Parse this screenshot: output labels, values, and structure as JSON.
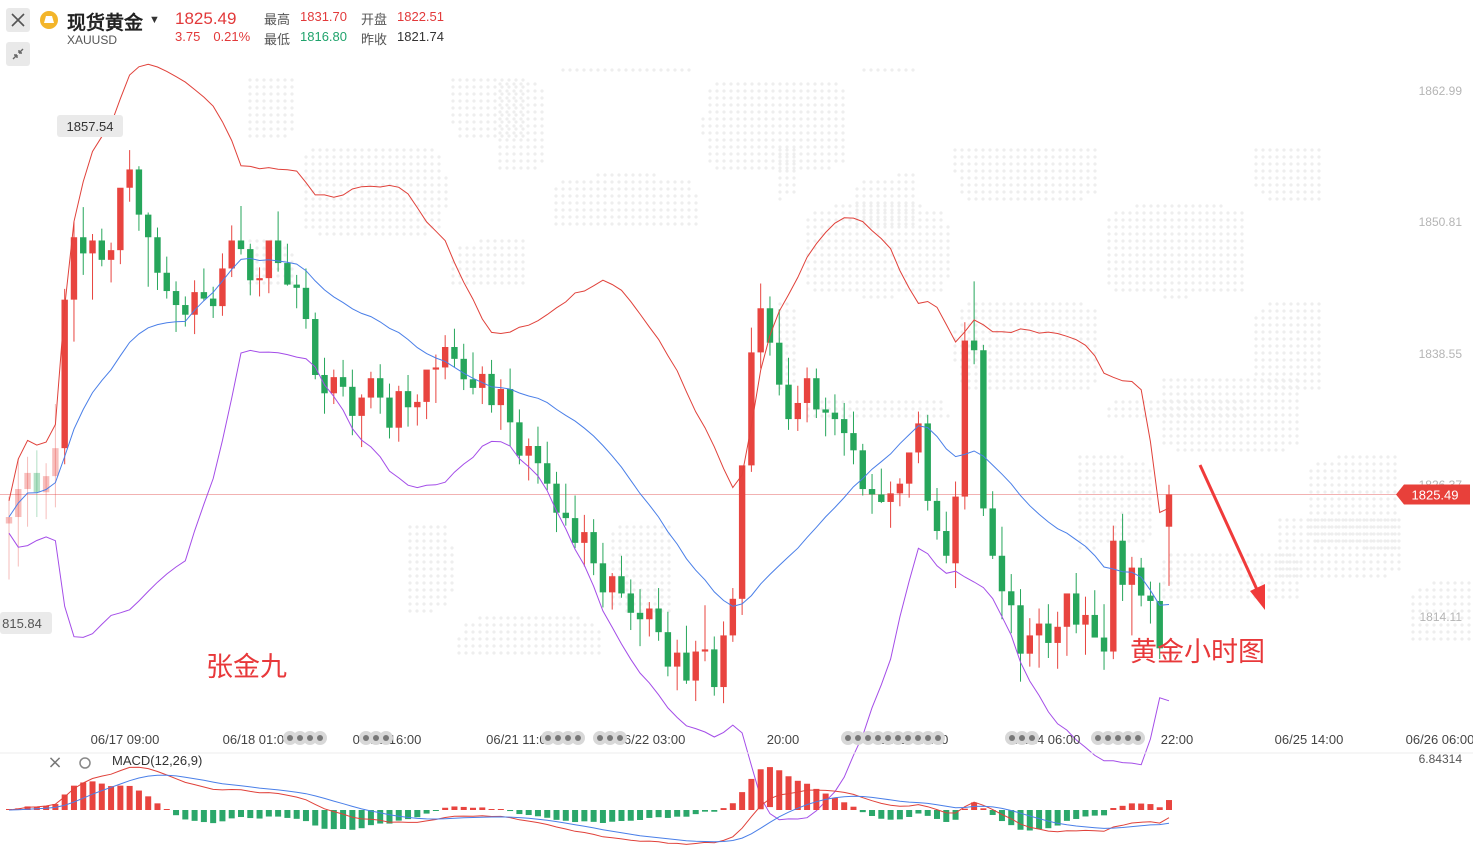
{
  "header": {
    "symbol_name": "现货黄金",
    "symbol_code": "XAUUSD",
    "last_price": "1825.49",
    "change": "3.75",
    "change_pct": "0.21%",
    "stats": [
      {
        "label": "最高",
        "value": "1831.70",
        "color": "#e2393a"
      },
      {
        "label": "开盘",
        "value": "1822.51",
        "color": "#e2393a"
      },
      {
        "label": "最低",
        "value": "1816.80",
        "color": "#1fa36c"
      },
      {
        "label": "昨收",
        "value": "1821.74",
        "color": "#333333"
      }
    ]
  },
  "toolbar": {
    "close_icon": "close-icon",
    "collapse_icon": "collapse-arrows-icon"
  },
  "annotations": {
    "author": "张金九",
    "caption": "黄金小时图",
    "max_label": "1857.54",
    "min_label": "815.84"
  },
  "macd": {
    "label": "MACD(12,26,9)",
    "axis_value": "6.84314"
  },
  "colors": {
    "up": "#e8443f",
    "down": "#26a65b",
    "upper_band": "#e0413a",
    "mid_band": "#4a7fe8",
    "lower_band": "#a44de8",
    "price_line": "#e05050",
    "macd_up": "#e8443f",
    "macd_down": "#2ba76a"
  },
  "chart_data": {
    "type": "candlestick",
    "title": "",
    "xlabel": "",
    "ylabel": "",
    "ylim": [
      1810.0,
      1867.6
    ],
    "y_ticks": [
      "1862.99",
      "1850.81",
      "1838.55",
      "1826.37",
      "1814.11"
    ],
    "current_price": "1825.49",
    "x_ticks": [
      "06/17 09:00",
      "06/18 01:00",
      "06/20 16:00",
      "06/21 11:00",
      "06/22 03:00",
      "20:00",
      "06/23 13:00",
      "06/24 06:00",
      "22:00",
      "06/25 14:00",
      "06/26 06:00"
    ],
    "candles_ohlc": [
      [
        1822.8,
        1825.3,
        1817.6,
        1823.4
      ],
      [
        1823.4,
        1828.8,
        1818.8,
        1826.0
      ],
      [
        1826.0,
        1829.0,
        1822.5,
        1827.5
      ],
      [
        1827.5,
        1829.6,
        1823.4,
        1825.7
      ],
      [
        1825.7,
        1828.4,
        1823.2,
        1827.2
      ],
      [
        1827.2,
        1833.9,
        1824.3,
        1829.8
      ],
      [
        1829.8,
        1844.6,
        1828.3,
        1843.6
      ],
      [
        1843.6,
        1850.8,
        1839.7,
        1849.4
      ],
      [
        1849.4,
        1852.2,
        1845.9,
        1847.9
      ],
      [
        1847.9,
        1849.7,
        1843.6,
        1849.1
      ],
      [
        1849.1,
        1850.2,
        1846.7,
        1847.3
      ],
      [
        1847.3,
        1848.9,
        1845.2,
        1848.2
      ],
      [
        1848.2,
        1852.0,
        1846.9,
        1854.0
      ],
      [
        1854.0,
        1857.5,
        1852.7,
        1855.7
      ],
      [
        1855.7,
        1856.0,
        1850.0,
        1851.5
      ],
      [
        1851.5,
        1851.7,
        1844.8,
        1849.4
      ],
      [
        1849.4,
        1850.3,
        1844.5,
        1846.1
      ],
      [
        1846.1,
        1847.6,
        1843.7,
        1844.4
      ],
      [
        1844.4,
        1845.3,
        1840.6,
        1843.1
      ],
      [
        1843.1,
        1843.9,
        1841.1,
        1842.2
      ],
      [
        1842.2,
        1845.4,
        1840.4,
        1844.3
      ],
      [
        1844.3,
        1846.5,
        1843.5,
        1843.7
      ],
      [
        1843.7,
        1844.8,
        1841.9,
        1843.0
      ],
      [
        1843.0,
        1847.9,
        1842.1,
        1846.5
      ],
      [
        1846.5,
        1850.5,
        1845.7,
        1849.1
      ],
      [
        1849.1,
        1852.3,
        1847.8,
        1848.3
      ],
      [
        1848.3,
        1848.8,
        1844.0,
        1845.4
      ],
      [
        1845.4,
        1846.6,
        1843.9,
        1845.6
      ],
      [
        1845.6,
        1848.0,
        1844.2,
        1849.1
      ],
      [
        1849.1,
        1851.8,
        1846.2,
        1847.0
      ],
      [
        1847.0,
        1848.8,
        1844.9,
        1845.0
      ],
      [
        1845.0,
        1845.9,
        1842.8,
        1844.7
      ],
      [
        1844.7,
        1846.5,
        1840.9,
        1841.8
      ],
      [
        1841.8,
        1842.4,
        1836.2,
        1836.6
      ],
      [
        1836.6,
        1838.2,
        1833.0,
        1834.9
      ],
      [
        1834.9,
        1837.1,
        1833.9,
        1836.4
      ],
      [
        1836.4,
        1838.0,
        1834.6,
        1835.5
      ],
      [
        1835.5,
        1837.1,
        1831.0,
        1832.8
      ],
      [
        1832.8,
        1834.8,
        1829.9,
        1834.5
      ],
      [
        1834.5,
        1836.9,
        1833.5,
        1836.3
      ],
      [
        1836.3,
        1837.6,
        1833.0,
        1834.5
      ],
      [
        1834.5,
        1835.8,
        1830.7,
        1831.7
      ],
      [
        1831.7,
        1835.6,
        1830.4,
        1835.1
      ],
      [
        1835.1,
        1836.6,
        1831.8,
        1833.6
      ],
      [
        1833.6,
        1834.8,
        1831.9,
        1834.1
      ],
      [
        1834.1,
        1836.5,
        1832.5,
        1837.1
      ],
      [
        1837.1,
        1838.5,
        1834.0,
        1837.3
      ],
      [
        1837.3,
        1840.3,
        1836.2,
        1839.2
      ],
      [
        1839.2,
        1840.9,
        1837.3,
        1838.1
      ],
      [
        1838.1,
        1839.5,
        1835.2,
        1836.2
      ],
      [
        1836.2,
        1838.7,
        1834.8,
        1835.4
      ],
      [
        1835.4,
        1837.4,
        1833.9,
        1836.7
      ],
      [
        1836.7,
        1838.0,
        1833.1,
        1833.8
      ],
      [
        1833.8,
        1836.2,
        1831.5,
        1835.3
      ],
      [
        1835.3,
        1837.2,
        1830.0,
        1832.2
      ],
      [
        1832.2,
        1833.4,
        1828.3,
        1829.1
      ],
      [
        1829.1,
        1830.7,
        1826.8,
        1830.0
      ],
      [
        1830.0,
        1831.8,
        1826.5,
        1828.4
      ],
      [
        1828.4,
        1830.4,
        1825.9,
        1826.5
      ],
      [
        1826.5,
        1827.6,
        1822.0,
        1823.8
      ],
      [
        1823.8,
        1826.5,
        1822.6,
        1823.3
      ],
      [
        1823.3,
        1825.4,
        1820.5,
        1821.0
      ],
      [
        1821.0,
        1823.6,
        1818.8,
        1822.0
      ],
      [
        1822.0,
        1823.2,
        1818.0,
        1819.1
      ],
      [
        1819.1,
        1821.0,
        1815.0,
        1816.4
      ],
      [
        1816.4,
        1818.2,
        1814.8,
        1817.9
      ],
      [
        1817.9,
        1819.8,
        1815.9,
        1816.3
      ],
      [
        1816.3,
        1817.6,
        1812.9,
        1814.5
      ],
      [
        1814.5,
        1816.7,
        1811.4,
        1813.9
      ],
      [
        1813.9,
        1815.5,
        1812.3,
        1814.9
      ],
      [
        1814.9,
        1816.8,
        1811.9,
        1812.7
      ],
      [
        1812.7,
        1814.6,
        1808.6,
        1809.5
      ],
      [
        1809.5,
        1812.0,
        1807.3,
        1810.8
      ],
      [
        1810.8,
        1813.3,
        1807.9,
        1808.2
      ],
      [
        1808.2,
        1811.9,
        1806.3,
        1810.9
      ],
      [
        1810.9,
        1815.2,
        1810.0,
        1811.1
      ],
      [
        1811.1,
        1812.3,
        1806.8,
        1807.6
      ],
      [
        1807.6,
        1813.7,
        1806.1,
        1812.4
      ],
      [
        1812.4,
        1816.8,
        1811.8,
        1815.8
      ],
      [
        1815.8,
        1825.1,
        1814.3,
        1828.2
      ],
      [
        1828.2,
        1841.0,
        1827.6,
        1838.7
      ],
      [
        1838.7,
        1845.1,
        1837.2,
        1842.8
      ],
      [
        1842.8,
        1843.9,
        1838.4,
        1839.6
      ],
      [
        1839.6,
        1842.7,
        1834.7,
        1835.7
      ],
      [
        1835.7,
        1838.2,
        1831.5,
        1832.5
      ],
      [
        1832.5,
        1835.6,
        1831.4,
        1834.0
      ],
      [
        1834.0,
        1837.3,
        1832.2,
        1836.3
      ],
      [
        1836.3,
        1837.2,
        1832.6,
        1833.4
      ],
      [
        1833.4,
        1834.5,
        1830.9,
        1833.1
      ],
      [
        1833.1,
        1834.8,
        1831.0,
        1832.5
      ],
      [
        1832.5,
        1834.0,
        1829.1,
        1831.2
      ],
      [
        1831.2,
        1833.2,
        1828.3,
        1829.6
      ],
      [
        1829.6,
        1830.2,
        1825.4,
        1826.0
      ],
      [
        1826.0,
        1827.4,
        1823.7,
        1825.5
      ],
      [
        1825.5,
        1827.9,
        1824.7,
        1824.8
      ],
      [
        1824.8,
        1826.7,
        1822.4,
        1825.6
      ],
      [
        1825.6,
        1827.0,
        1824.4,
        1826.5
      ],
      [
        1826.5,
        1829.4,
        1825.2,
        1829.4
      ],
      [
        1829.4,
        1833.2,
        1828.4,
        1832.1
      ],
      [
        1832.1,
        1832.9,
        1824.0,
        1824.9
      ],
      [
        1824.9,
        1826.1,
        1821.3,
        1822.1
      ],
      [
        1822.1,
        1823.9,
        1819.1,
        1819.8
      ],
      [
        1819.1,
        1826.7,
        1816.8,
        1825.3
      ],
      [
        1825.3,
        1841.5,
        1824.1,
        1839.8
      ],
      [
        1839.8,
        1845.3,
        1837.6,
        1838.9
      ],
      [
        1838.9,
        1839.4,
        1823.5,
        1824.2
      ],
      [
        1824.2,
        1825.8,
        1819.5,
        1819.8
      ],
      [
        1819.8,
        1822.5,
        1813.9,
        1816.5
      ],
      [
        1816.5,
        1818.1,
        1812.6,
        1815.2
      ],
      [
        1815.2,
        1816.7,
        1808.1,
        1810.7
      ],
      [
        1810.7,
        1814.0,
        1809.5,
        1812.4
      ],
      [
        1812.4,
        1814.9,
        1809.4,
        1813.5
      ],
      [
        1813.5,
        1815.3,
        1810.3,
        1811.7
      ],
      [
        1811.7,
        1814.6,
        1809.3,
        1813.2
      ],
      [
        1813.2,
        1815.6,
        1810.5,
        1816.3
      ],
      [
        1816.3,
        1818.2,
        1812.6,
        1813.4
      ],
      [
        1813.4,
        1816.0,
        1810.6,
        1814.3
      ],
      [
        1814.3,
        1816.6,
        1812.6,
        1812.2
      ],
      [
        1812.2,
        1815.3,
        1809.2,
        1810.9
      ],
      [
        1810.9,
        1822.6,
        1810.2,
        1821.2
      ],
      [
        1821.2,
        1823.7,
        1815.6,
        1817.1
      ],
      [
        1817.1,
        1819.7,
        1812.4,
        1818.7
      ],
      [
        1818.7,
        1819.6,
        1815.1,
        1816.1
      ],
      [
        1816.1,
        1817.4,
        1813.5,
        1815.6
      ],
      [
        1815.6,
        1817.3,
        1810.2,
        1811.2
      ],
      [
        1822.5,
        1826.4,
        1817.0,
        1825.5
      ]
    ],
    "macd": {
      "axis_max": "6.84314"
    }
  }
}
